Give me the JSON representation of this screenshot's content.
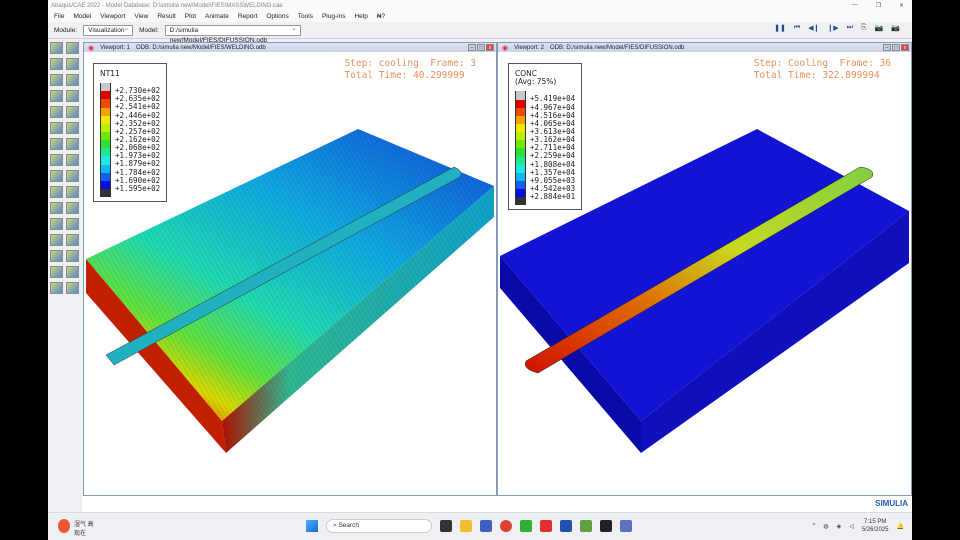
{
  "window": {
    "title": "Abaqus/CAE 2022 - Model Database: D:\\simulia new\\Model\\FIES\\MASSWELDING.cae"
  },
  "menu": [
    "File",
    "Model",
    "Viewport",
    "View",
    "Result",
    "Plot",
    "Animate",
    "Report",
    "Options",
    "Tools",
    "Plug-ins",
    "Help",
    "₦?"
  ],
  "toolbar": {
    "module_label": "Module:",
    "module_value": "Visualization",
    "model_label": "Model:",
    "model_value": "D:/simulia new/Model/FIES/DIFUSSION.odb"
  },
  "animation_controls": [
    "pause",
    "first-frame",
    "previous-frame",
    "next-frame",
    "last-frame"
  ],
  "viewport1": {
    "title": "Viewport: 1",
    "odb": "ODB: D:/simulia new/Model/FIES/WELDING.odb",
    "legend_title": "NT11",
    "legend_sub": "",
    "legend_values": [
      "+2.730e+02",
      "+2.635e+02",
      "+2.541e+02",
      "+2.446e+02",
      "+2.352e+02",
      "+2.257e+02",
      "+2.162e+02",
      "+2.068e+02",
      "+1.973e+02",
      "+1.879e+02",
      "+1.784e+02",
      "+1.690e+02",
      "+1.595e+02"
    ],
    "step": "Step: cooling  Frame: 3",
    "time": "Total Time: 40.299999"
  },
  "viewport2": {
    "title": "Viewport: 2",
    "odb": "ODB: D:/simulia new/Model/FIES/DIFUSSION.odb",
    "legend_title": "CONC",
    "legend_sub": "(Avg: 75%)",
    "legend_values": [
      "+5.419e+04",
      "+4.967e+04",
      "+4.516e+04",
      "+4.065e+04",
      "+3.613e+04",
      "+3.162e+04",
      "+2.711e+04",
      "+2.259e+04",
      "+1.808e+04",
      "+1.357e+04",
      "+9.055e+03",
      "+4.542e+03",
      "+2.884e+01"
    ],
    "step": "Step: Cooling  Frame: 36",
    "time": "Total Time: 322.899994"
  },
  "legend_colors": [
    "#c8c8c8",
    "#e00000",
    "#f04a00",
    "#f7a000",
    "#f0e800",
    "#b8f000",
    "#70e800",
    "#30e030",
    "#20e890",
    "#20e8e0",
    "#10b8f0",
    "#1060f0",
    "#0010e0",
    "#333333"
  ],
  "brand": "SIMULIA",
  "taskbar": {
    "weather": "湿气 高",
    "weather2": "现在",
    "search_placeholder": "Search",
    "time": "7:15 PM",
    "date": "5/26/2025"
  }
}
